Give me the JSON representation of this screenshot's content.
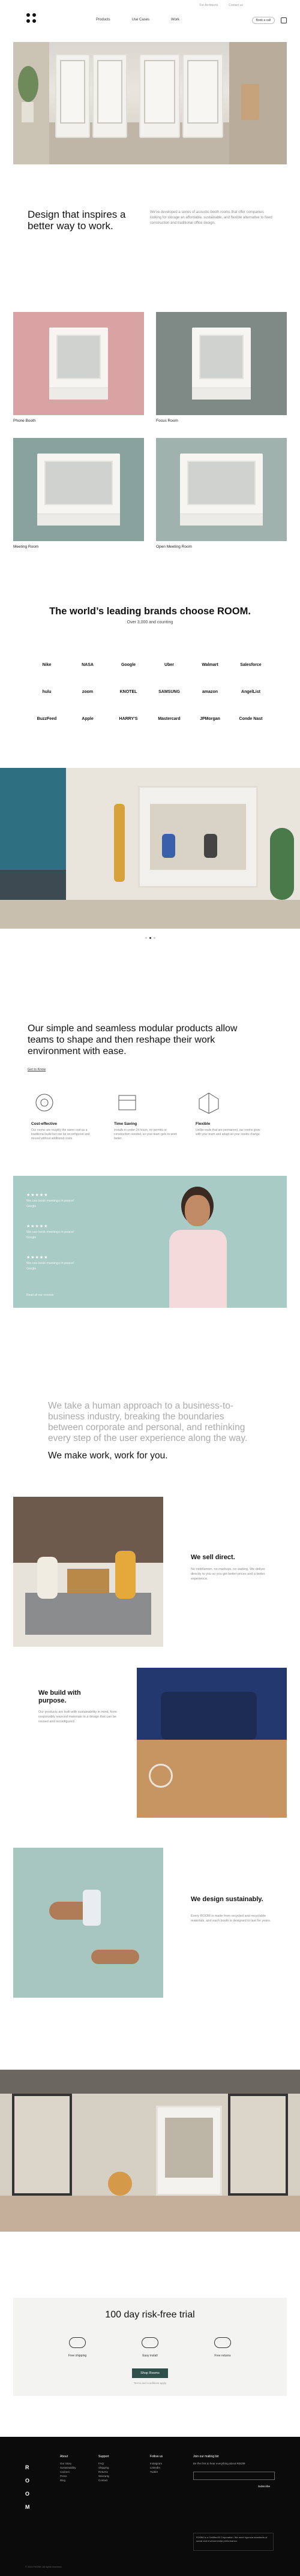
{
  "nav": {
    "items": [
      "Products",
      "Use Cases",
      "Work"
    ],
    "utility_links": [
      "For Architects",
      "Contact us"
    ],
    "book_call": "Book a call",
    "cart_count": "0"
  },
  "intro": {
    "title": "Design that inspires a better way to work.",
    "text": "We've developed a series of acoustic booth rooms that offer companies looking for storage an affordable, sustainable, and flexible alternative to fixed construction and traditional office design."
  },
  "products": [
    {
      "label": "Phone Booth",
      "color": "#d9a3a4"
    },
    {
      "label": "Focus Room",
      "color": "#7f8a86"
    },
    {
      "label": "Meeting Room",
      "color": "#88a29e"
    },
    {
      "label": "Open Meeting Room",
      "color": "#9fb2ad"
    }
  ],
  "brands": {
    "title": "The world’s leading brands choose ROOM.",
    "subtitle": "Over 3,000 and counting",
    "logos": [
      "Nike",
      "NASA",
      "Google",
      "Uber",
      "Walmart",
      "Salesforce",
      "hulu",
      "zoom",
      "KNOTEL",
      "SAMSUNG",
      "amazon",
      "AngelList",
      "BuzzFeed",
      "Apple",
      "HARRY'S",
      "Mastercard",
      "JPMorgan",
      "Conde Nast"
    ]
  },
  "modular": {
    "title": "Our simple and seamless modular products allow teams to shape and then reshape their work environment with ease.",
    "link": "Get to Know",
    "features": [
      {
        "title": "Cost-effective",
        "text": "Our rooms are roughly the same cost as a traditional build but can be reconfigured and moved without additional costs."
      },
      {
        "title": "Time Saving",
        "text": "Installs in under 24 hours, no permits or construction needed, so your team gets to work faster."
      },
      {
        "title": "Flexible",
        "text": "Unlike walls that are permanent, our rooms grow with your team and adapt as your needs change."
      }
    ]
  },
  "testimonials": [
    {
      "stars": "★★★★★",
      "quote": "We can book meetings in peace!",
      "source": "Google"
    },
    {
      "stars": "★★★★★",
      "quote": "We can book meetings in peace!",
      "source": "Google"
    },
    {
      "stars": "★★★★★",
      "quote": "We can book meetings in peace!",
      "source": "Google"
    }
  ],
  "testimonial_footer": "Read all our reviews",
  "approach": {
    "text": "We take a human approach to a business-to-business industry, breaking the boundaries between corporate and personal, and rethinking every step of the user experience along the way.",
    "bold": "We make work, work for you."
  },
  "stories": [
    {
      "title": "We sell direct.",
      "text": "No middlemen, no markups, no waiting. We deliver directly to you so you get better prices and a better experience."
    },
    {
      "title": "We build with purpose.",
      "text": "Our products are built with sustainability in mind, from responsibly sourced materials to a design that can be reused and reconfigured."
    },
    {
      "title": "We design sustainably.",
      "text": "Every ROOM is made from recycled and recyclable materials, and each booth is designed to last for years."
    }
  ],
  "trial": {
    "title": "100 day risk-free trial",
    "items": [
      "Free shipping",
      "Easy install",
      "Free returns"
    ],
    "button": "Shop Rooms",
    "note": "Terms and conditions apply"
  },
  "footer": {
    "logo": [
      "R",
      "O",
      "O",
      "M"
    ],
    "cols": [
      {
        "head": "About",
        "items": [
          "Our Story",
          "Sustainability",
          "Careers",
          "Press",
          "Blog"
        ]
      },
      {
        "head": "Support",
        "items": [
          "FAQ",
          "Shipping",
          "Returns",
          "Warranty",
          "Contact"
        ]
      },
      {
        "head": "Follow us",
        "items": [
          "Instagram",
          "LinkedIn",
          "Twitter"
        ]
      }
    ],
    "newsletter": "Join our mailing list",
    "newsletter_sub": "Be the first to hear everything about ROOM",
    "subscribe": "Subscribe",
    "badge": "ROOM is a Certified B Corporation. We meet rigorous standards of social and environmental performance.",
    "copyright": "© 2021 ROOM. All rights reserved."
  }
}
